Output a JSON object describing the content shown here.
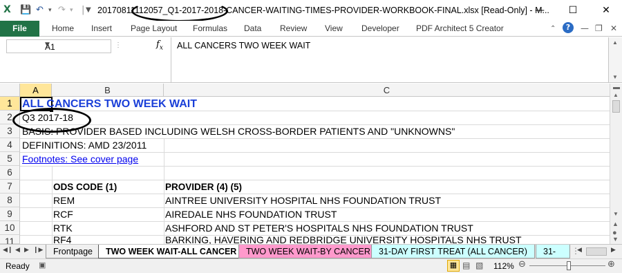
{
  "window": {
    "title": "20170811112057_Q1-2017-2018-CANCER-WAITING-TIMES-PROVIDER-WORKBOOK-FINAL.xlsx  [Read-Only]  -  M...",
    "save_icon": "save-icon",
    "undo_icon": "undo-icon",
    "redo_icon": "redo-icon",
    "minimize_icon": "minimize-icon",
    "maximize_icon": "maximize-icon",
    "close_icon": "close-icon"
  },
  "ribbon": {
    "file_label": "File",
    "tabs": [
      "Home",
      "Insert",
      "Page Layout",
      "Formulas",
      "Data",
      "Review",
      "View",
      "Developer",
      "PDF Architect 5 Creator"
    ],
    "accent": "#217346"
  },
  "formula_bar": {
    "name_box": "A1",
    "fx_label": "fx",
    "formula": "ALL CANCERS TWO WEEK WAIT"
  },
  "grid": {
    "columns": [
      "A",
      "B",
      "C"
    ],
    "rows": [
      "1",
      "2",
      "3",
      "4",
      "5",
      "6",
      "7",
      "8",
      "9",
      "10",
      "11"
    ],
    "cells": {
      "r1": "ALL CANCERS TWO WEEK WAIT",
      "r2": "Q3 2017-18",
      "r3": "BASIS: PROVIDER BASED INCLUDING WELSH CROSS-BORDER PATIENTS AND \"UNKNOWNS\"",
      "r4": "DEFINITIONS: AMD 23/2011",
      "r5": "Footnotes: See cover page",
      "r7b": "ODS CODE (1)",
      "r7c": "PROVIDER (4) (5)",
      "r8b": "REM",
      "r8c": "AINTREE UNIVERSITY HOSPITAL NHS FOUNDATION TRUST",
      "r9b": "RCF",
      "r9c": "AIREDALE NHS FOUNDATION TRUST",
      "r10b": "RTK",
      "r10c": "ASHFORD AND ST PETER'S HOSPITALS NHS FOUNDATION TRUST",
      "r11b": "RF4",
      "r11c": "BARKING, HAVERING AND REDBRIDGE UNIVERSITY HOSPITALS NHS TRUST"
    }
  },
  "sheets": {
    "tabs": [
      "Frontpage",
      "TWO WEEK WAIT-ALL CANCER",
      "TWO WEEK WAIT-BY CANCER",
      "31-DAY FIRST TREAT (ALL CANCER)",
      "31-"
    ],
    "tab_colors": [
      "#ffffff",
      "#ffffff",
      "#ff99cc",
      "#ccffff",
      "#ccffff"
    ]
  },
  "status": {
    "mode": "Ready",
    "zoom": "112%",
    "zoom_level_percent": 112
  }
}
